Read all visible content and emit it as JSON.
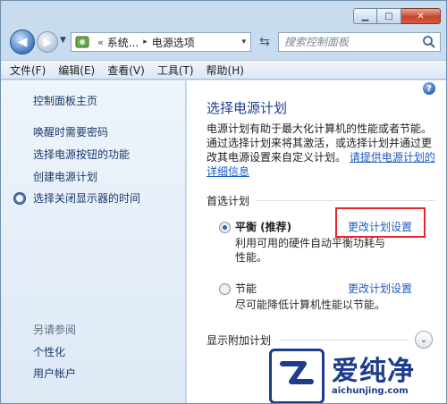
{
  "window": {
    "caption": {
      "minimize": "▁",
      "maximize": "□",
      "close": "✕"
    }
  },
  "address_bar": {
    "back_icon": "back-arrow-icon",
    "forward_icon": "forward-arrow-icon",
    "chevron": "«",
    "crumb_1": "系统...",
    "separator": "▸",
    "crumb_2": "电源选项",
    "dropdown": "▾",
    "refresh_icon": "refresh-icon",
    "search_placeholder": "搜索控制面板"
  },
  "menubar": {
    "items": [
      "文件(F)",
      "编辑(E)",
      "查看(V)",
      "工具(T)",
      "帮助(H)"
    ]
  },
  "left_pane": {
    "home_link": "控制面板主页",
    "links": [
      "唤醒时需要密码",
      "选择电源按钮的功能",
      "创建电源计划"
    ],
    "display_off_link": "选择关闭显示器的时间",
    "see_also": "另请参阅",
    "see_also_links": [
      "个性化",
      "用户帐户"
    ]
  },
  "main": {
    "title": "选择电源计划",
    "desc_text": "电源计划有助于最大化计算机的性能或者节能。通过选择计划来将其激活，或选择计划并通过更改其电源设置来自定义计划。",
    "desc_link": "请提供电源计划的详细信息",
    "section_label": "首选计划",
    "plans": [
      {
        "name": "平衡 (推荐)",
        "desc": "利用可用的硬件自动平衡功耗与性能。",
        "link": "更改计划设置",
        "selected": true
      },
      {
        "name": "节能",
        "desc": "尽可能降低计算机性能以节能。",
        "link": "更改计划设置",
        "selected": false
      }
    ],
    "expand_label": "显示附加计划",
    "expand_icon": "chevron-down-icon"
  },
  "watermark": {
    "title": "爱纯净",
    "url": "aichunjing.com"
  }
}
